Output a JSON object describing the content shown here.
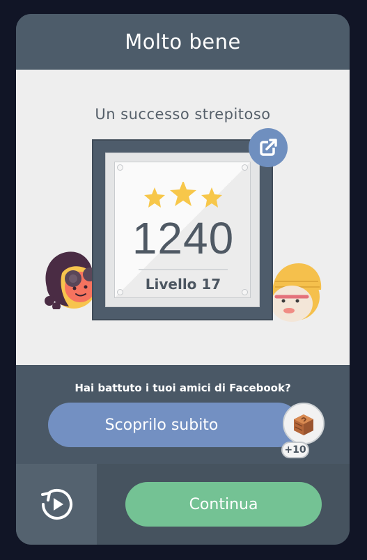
{
  "header": {
    "title": "Molto bene"
  },
  "result": {
    "subtitle": "Un successo strepitoso",
    "score": "1240",
    "level": "Livello 17",
    "stars": 3
  },
  "icons": {
    "share": "share-icon",
    "replay": "replay-icon",
    "reward": "crate-icon"
  },
  "social": {
    "prompt": "Hai battuto i tuoi amici di Facebook?",
    "button_label": "Scoprilo subito",
    "reward_badge": "+10"
  },
  "actions": {
    "continue_label": "Continua"
  },
  "colors": {
    "header": "#4d5c6a",
    "panel": "#eeeeee",
    "star": "#f7c74a",
    "share": "#6f8fbf",
    "facebook_button": "#7390c2",
    "continue_button": "#74c294"
  }
}
